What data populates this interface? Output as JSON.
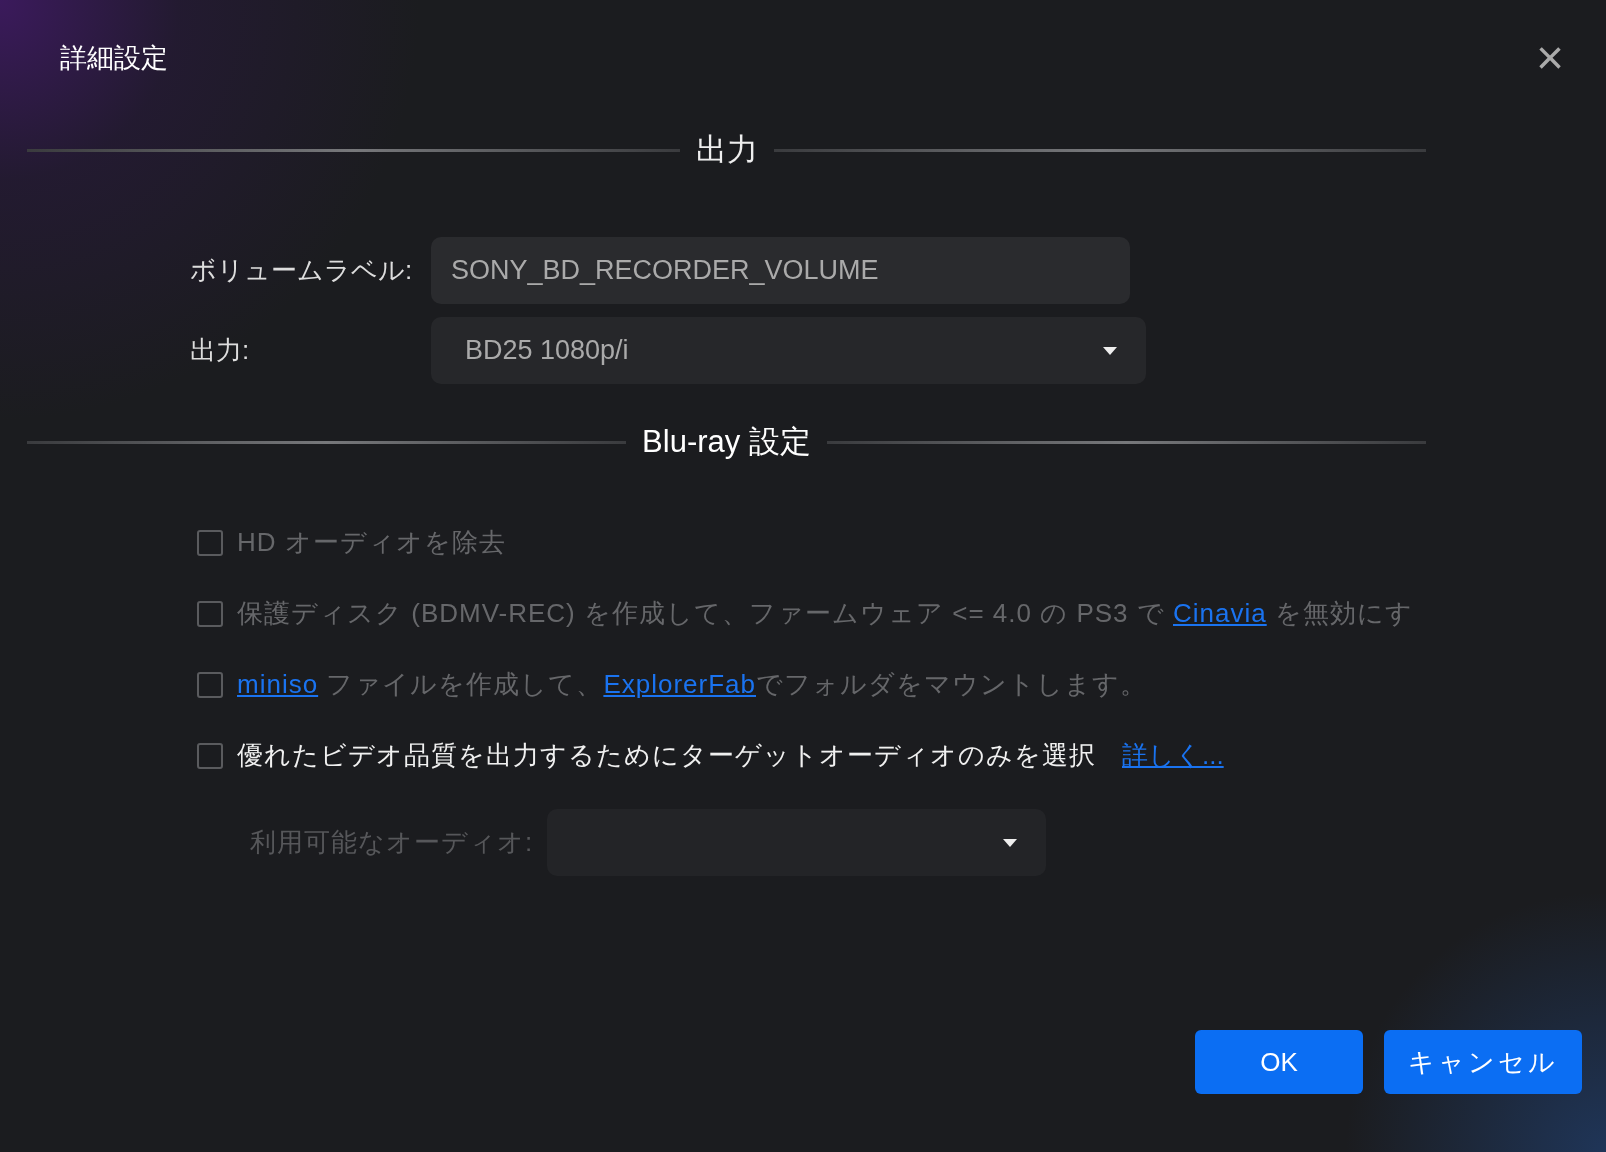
{
  "dialog": {
    "title": "詳細設定",
    "close": "×"
  },
  "output_section": {
    "heading": "出力",
    "volume_label": {
      "label": "ボリュームラベル:",
      "value": "SONY_BD_RECORDER_VOLUME"
    },
    "output": {
      "label": "出力:",
      "value": "BD25 1080p/i"
    }
  },
  "bluray_section": {
    "heading": "Blu-ray 設定",
    "options": [
      {
        "checked": false,
        "disabled": true,
        "parts": [
          {
            "kind": "text",
            "text": "HD オーディオを除去"
          }
        ]
      },
      {
        "checked": false,
        "disabled": true,
        "parts": [
          {
            "kind": "text",
            "text": "保護ディスク (BDMV-REC) を作成して、ファームウェア <= 4.0 の PS3 で "
          },
          {
            "kind": "link",
            "text": "Cinavia"
          },
          {
            "kind": "text",
            "text": " を無効にす"
          }
        ]
      },
      {
        "checked": false,
        "disabled": true,
        "parts": [
          {
            "kind": "link",
            "text": "miniso"
          },
          {
            "kind": "text",
            "text": " ファイルを作成して、"
          },
          {
            "kind": "link",
            "text": "ExplorerFab"
          },
          {
            "kind": "text",
            "text": "でフォルダをマウントします。"
          }
        ]
      },
      {
        "checked": false,
        "disabled": false,
        "parts": [
          {
            "kind": "text",
            "text": "優れたビデオ品質を出力するためにターゲットオーディオのみを選択"
          }
        ],
        "link": "詳しく..."
      }
    ],
    "available_audio": {
      "label": "利用可能なオーディオ:",
      "disabled": true
    }
  },
  "buttons": [
    {
      "label": "OK"
    },
    {
      "label": "キャンセル"
    }
  ]
}
